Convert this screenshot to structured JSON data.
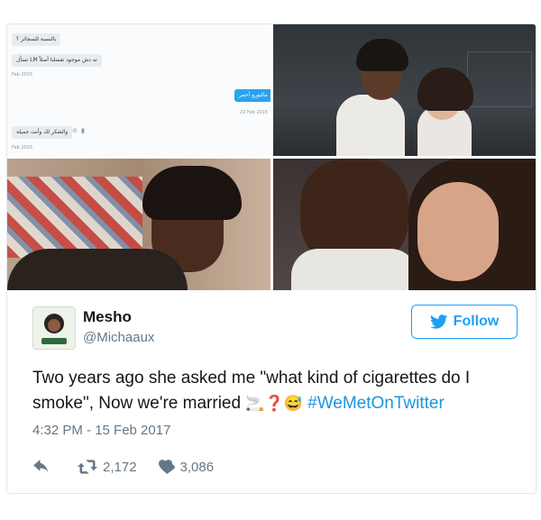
{
  "dm": {
    "msg1": "بالنسبة للسجائر ؟",
    "msg2": "تسأل LM نه دش موجود تفضلنا أصلاً",
    "stamp1": "Feb 2015",
    "msg3": "مالبورو أحمر",
    "stamp2": "22 Feb 2015",
    "msg4": "والشكر لك وأنت جميلة",
    "stamp3": "Feb 2015"
  },
  "tweet": {
    "display_name": "Mesho",
    "handle": "@Michaaux",
    "follow_label": "Follow",
    "text_main": "Two years ago she asked me \"what kind of cigarettes do I smoke\", Now we're married ",
    "emoji": "🚬❓😅",
    "hashtag": "#WeMetOnTwitter",
    "timestamp": "4:32 PM - 15 Feb 2017",
    "retweets": "2,172",
    "likes": "3,086"
  },
  "colors": {
    "brand": "#1da1f2",
    "hashtag": "#1b95e0",
    "muted": "#657786"
  },
  "icons": [
    "reply-icon",
    "retweet-icon",
    "heart-icon",
    "twitter-bird-icon"
  ]
}
